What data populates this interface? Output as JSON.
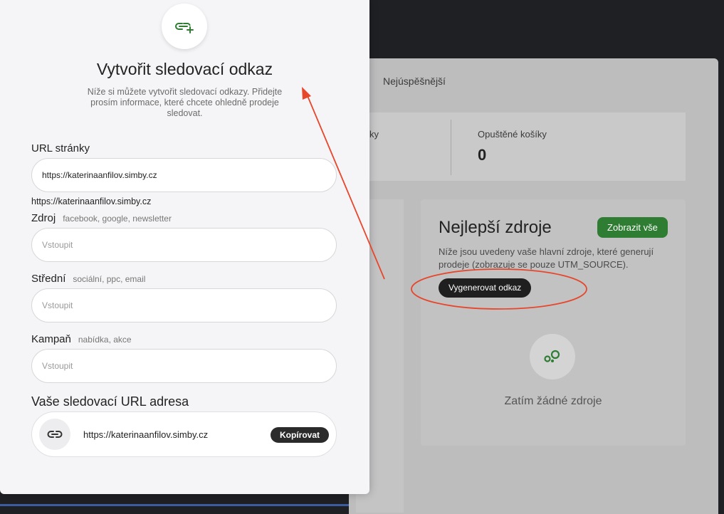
{
  "background": {
    "tab_label": "Nejúspěšnější",
    "stats": {
      "left_partial_label": "ky",
      "abandoned_label": "Opuštěné košíky",
      "abandoned_value": "0"
    },
    "sources_card": {
      "title": "Nejlepší zdroje",
      "show_all_label": "Zobrazit vše",
      "description": "Níže jsou uvedeny vaše hlavní zdroje, které generují prodeje (zobrazuje se pouze UTM_SOURCE).",
      "generate_link_label": "Vygenerovat odkaz",
      "empty_icon": "sources-icon",
      "empty_text": "Zatím žádné zdroje"
    }
  },
  "modal": {
    "icon": "link-plus-icon",
    "title": "Vytvořit sledovací odkaz",
    "subtitle": "Níže si můžete vytvořit sledovací odkazy. Přidejte prosím informace, které chcete ohledně prodeje sledovat.",
    "url_field": {
      "label": "URL stránky",
      "value": "https://katerinaanfilov.simby.cz",
      "preview": "https://katerinaanfilov.simby.cz"
    },
    "source_field": {
      "label": "Zdroj",
      "hint": "facebook, google, newsletter",
      "placeholder": "Vstoupit",
      "value": ""
    },
    "medium_field": {
      "label": "Střední",
      "hint": "sociální, ppc, email",
      "placeholder": "Vstoupit",
      "value": ""
    },
    "campaign_field": {
      "label": "Kampaň",
      "hint": "nabídka, akce",
      "placeholder": "Vstoupit",
      "value": ""
    },
    "result": {
      "title": "Vaše sledovací URL adresa",
      "icon": "link-icon",
      "url": "https://katerinaanfilov.simby.cz",
      "copy_label": "Kopírovat"
    }
  },
  "colors": {
    "accent_green": "#2e7d32",
    "annotation_red": "#e8462b",
    "dark_button": "#1f1f1f"
  }
}
